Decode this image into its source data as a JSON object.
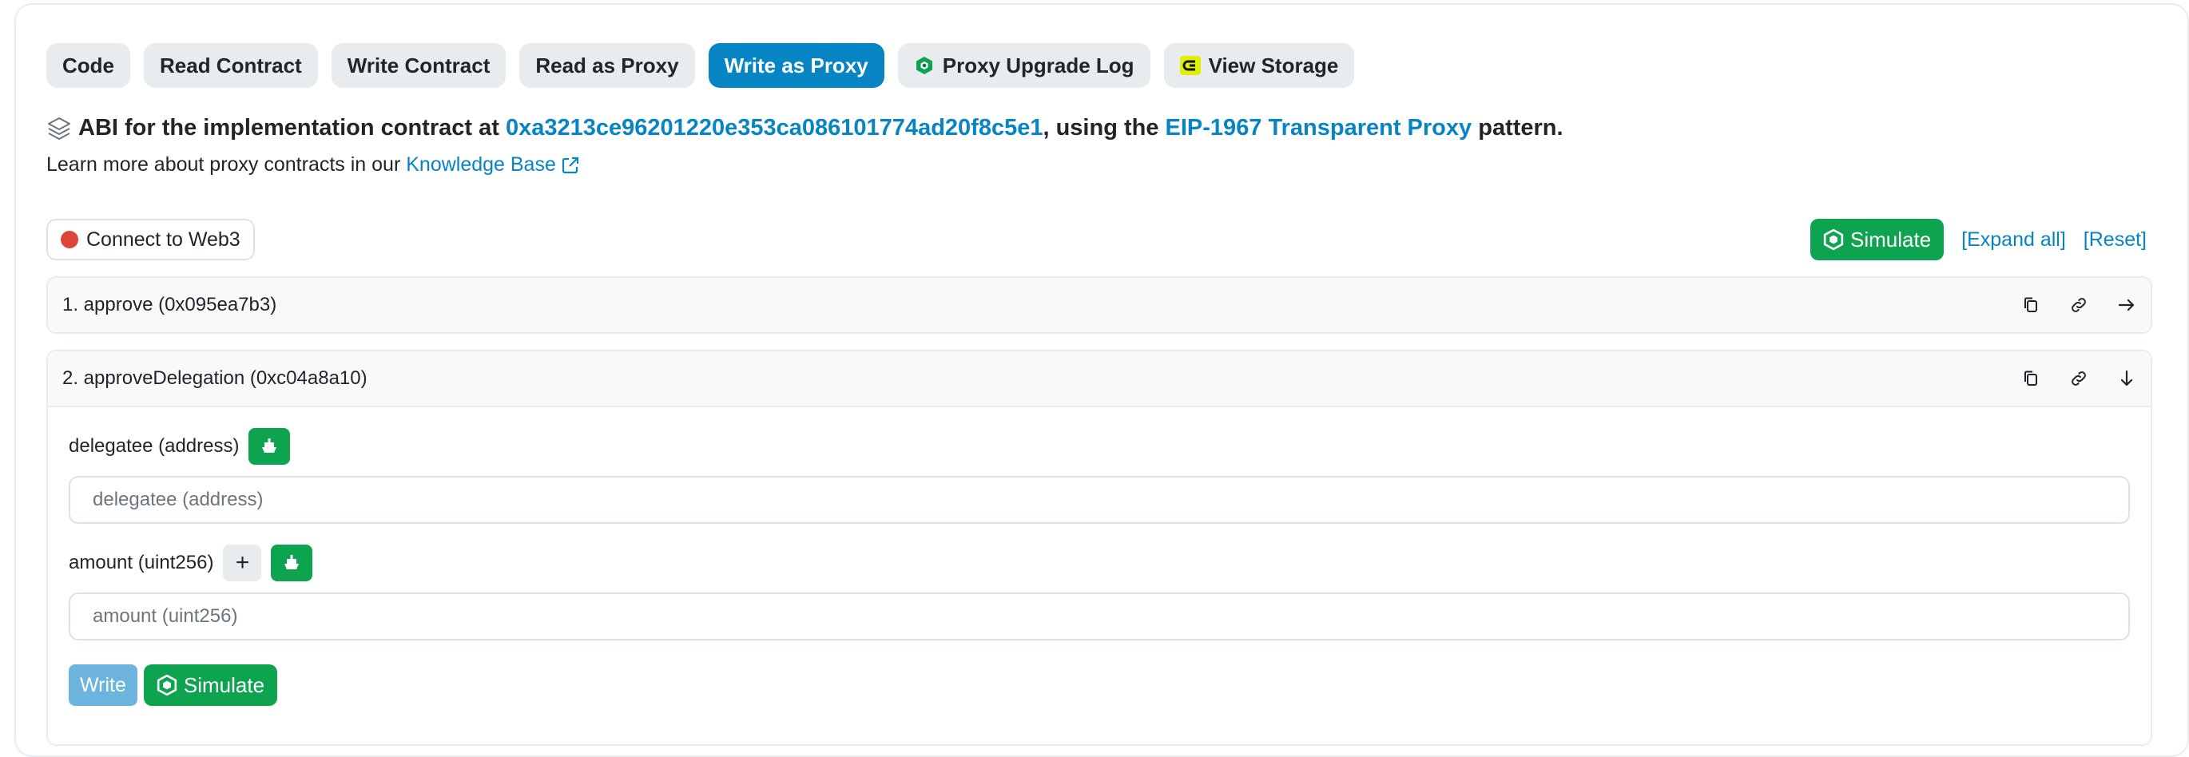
{
  "tabs": [
    {
      "label": "Code",
      "active": false
    },
    {
      "label": "Read Contract",
      "active": false
    },
    {
      "label": "Write Contract",
      "active": false
    },
    {
      "label": "Read as Proxy",
      "active": false
    },
    {
      "label": "Write as Proxy",
      "active": true
    },
    {
      "label": "Proxy Upgrade Log",
      "active": false,
      "icon": "tenderly-hex-icon"
    },
    {
      "label": "View Storage",
      "active": false,
      "icon": "storage-logo-icon"
    }
  ],
  "abi": {
    "prefix": "ABI for the implementation contract at ",
    "address": "0xa3213ce96201220e353ca086101774ad20f8c5e1",
    "middle": ", using the ",
    "pattern_link": "EIP-1967 Transparent Proxy",
    "suffix": " pattern."
  },
  "learn": {
    "text": "Learn more about proxy contracts in our ",
    "link": "Knowledge Base"
  },
  "connect_label": "Connect to Web3",
  "actions": {
    "simulate": "Simulate",
    "expand_all": "[Expand all]",
    "reset": "[Reset]"
  },
  "functions": [
    {
      "title": "1. approve (0x095ea7b3)",
      "expanded": false
    },
    {
      "title": "2. approveDelegation (0xc04a8a10)",
      "expanded": true,
      "params": [
        {
          "label": "delegatee (address)",
          "placeholder": "delegatee (address)",
          "value": ""
        },
        {
          "label": "amount (uint256)",
          "placeholder": "amount (uint256)",
          "value": "",
          "plus": "+"
        }
      ],
      "write": "Write",
      "simulate": "Simulate"
    }
  ],
  "colors": {
    "accent": "#0784c3",
    "green": "#0ea44f",
    "red_dot": "#de4437"
  }
}
